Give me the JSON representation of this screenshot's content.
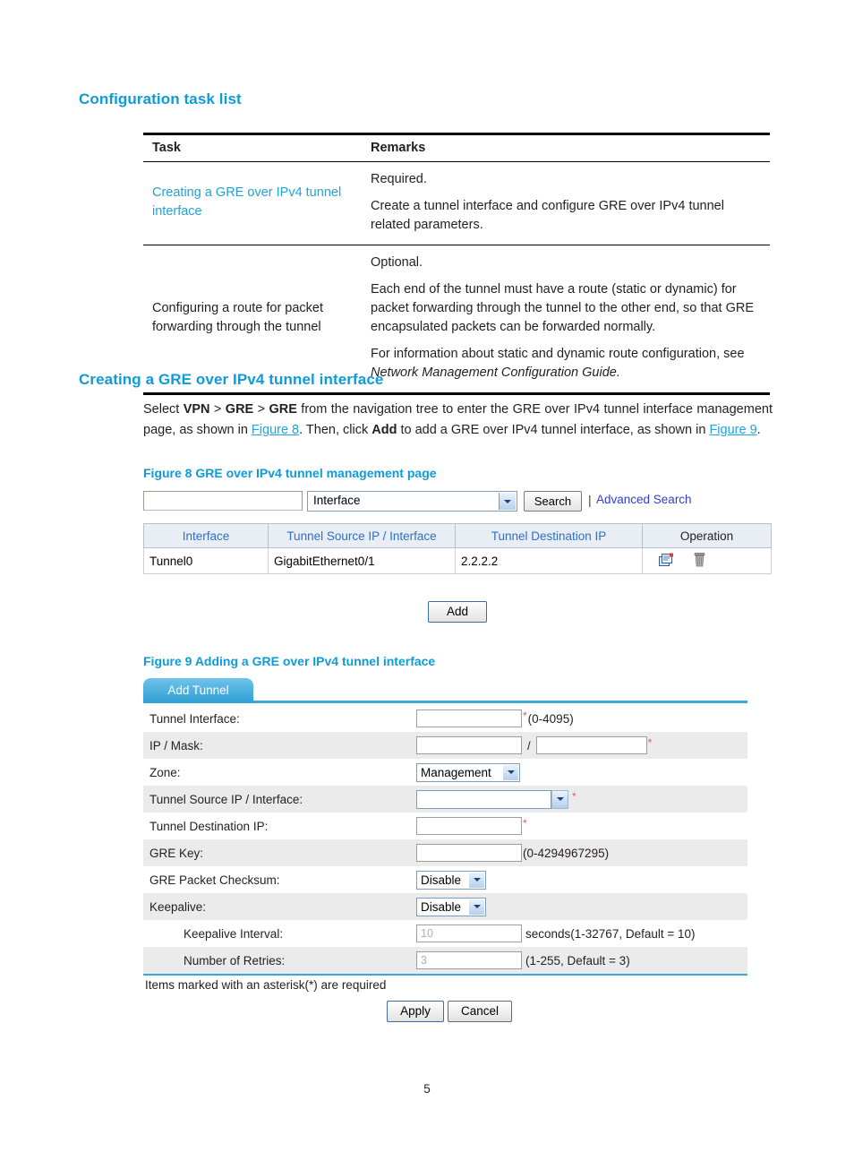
{
  "sections": {
    "task_list_heading": "Configuration task list",
    "creating_heading": "Creating a GRE over IPv4 tunnel interface"
  },
  "doc_table": {
    "headers": [
      "Task",
      "Remarks"
    ],
    "rows": [
      {
        "task": "Creating a GRE over IPv4 tunnel interface",
        "task_is_link": true,
        "remarks": [
          "Required.",
          "Create a tunnel interface and configure GRE over IPv4 tunnel related parameters."
        ]
      },
      {
        "task": "Configuring a route for packet forwarding through the tunnel",
        "task_is_link": false,
        "remarks": [
          "Optional.",
          "Each end of the tunnel must have a route (static or dynamic) for packet forwarding through the tunnel to the other end, so that GRE encapsulated packets can be forwarded normally.",
          "For information about static and dynamic route configuration, see Network Management Configuration Guide."
        ],
        "remarks_italic_tail": "Network Management Configuration Guide."
      }
    ]
  },
  "paragraph": {
    "p1_a": "Select ",
    "nav1": "VPN",
    "gt1": " > ",
    "nav2": "GRE",
    "gt2": " > ",
    "nav3": "GRE",
    "p1_b": " from the navigation tree to enter the GRE over IPv4 tunnel interface management page, as shown in ",
    "ref_fig8": "Figure 8",
    "p1_c": ". Then, click ",
    "bold_add": "Add",
    "p1_d": " to add a GRE over IPv4 tunnel interface, as shown in ",
    "ref_fig9": "Figure 9",
    "p1_e": "."
  },
  "figure8": {
    "caption": "Figure 8 GRE over IPv4 tunnel management page",
    "search": {
      "input_value": "",
      "input_placeholder": "",
      "select_value": "Interface",
      "search_button": "Search",
      "separator": "|",
      "advanced_link": "Advanced Search"
    },
    "table": {
      "headers": [
        "Interface",
        "Tunnel Source IP / Interface",
        "Tunnel Destination IP",
        "Operation"
      ],
      "rows": [
        {
          "interface": "Tunnel0",
          "source": "GigabitEthernet0/1",
          "destination": "2.2.2.2",
          "operations": [
            "edit-icon",
            "delete-icon"
          ]
        }
      ]
    },
    "add_button": "Add"
  },
  "figure9": {
    "caption": "Figure 9 Adding a GRE over IPv4 tunnel interface",
    "tab_label": "Add Tunnel",
    "fields": {
      "tunnel_interface": {
        "label": "Tunnel Interface:",
        "value": "",
        "required": "*",
        "hint": "(0-4095)"
      },
      "ip_mask": {
        "label": "IP / Mask:",
        "value": "",
        "mask_value": "",
        "separator": "/",
        "required": "*"
      },
      "zone": {
        "label": "Zone:",
        "value": "Management"
      },
      "tunnel_source": {
        "label": "Tunnel Source IP / Interface:",
        "value": "",
        "required": "*"
      },
      "tunnel_destination": {
        "label": "Tunnel Destination IP:",
        "value": "",
        "required": "*"
      },
      "gre_key": {
        "label": "GRE Key:",
        "value": "",
        "hint": "(0-4294967295)"
      },
      "gre_checksum": {
        "label": "GRE Packet Checksum:",
        "value": "Disable"
      },
      "keepalive": {
        "label": "Keepalive:",
        "value": "Disable"
      },
      "keepalive_interval": {
        "label": "Keepalive Interval:",
        "value": "10",
        "hint": "seconds(1-32767, Default = 10)"
      },
      "retries": {
        "label": "Number of Retries:",
        "value": "3",
        "hint": "(1-255, Default = 3)"
      }
    },
    "note": "Items marked with an asterisk(*) are required",
    "apply_button": "Apply",
    "cancel_button": "Cancel"
  },
  "footer": {
    "page_number": "5"
  },
  "colors": {
    "heading_blue": "#0e9cd8",
    "link_blue": "#1fa3dd",
    "grid_header_blue": "#2f6fc4",
    "tab_blue": "#2e9fd4",
    "required_red": "#e8566b",
    "web_link_blue": "#2b40d0"
  }
}
